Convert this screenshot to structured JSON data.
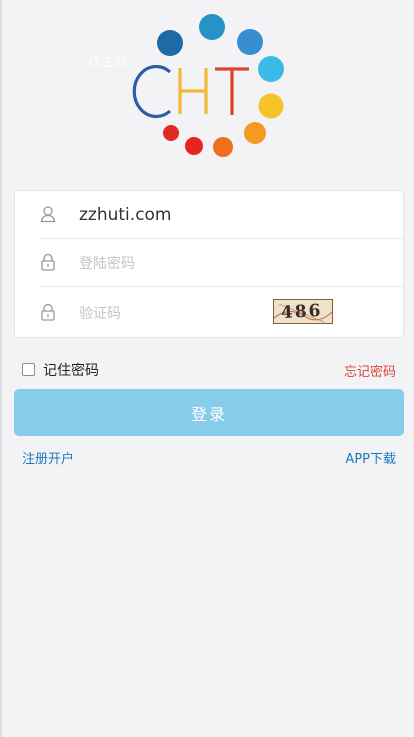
{
  "logo": {
    "letters": "CHT",
    "note": "找主题",
    "dot_colors": [
      "#1e6aa6",
      "#2593c7",
      "#3a8ed0",
      "#3bbbe8",
      "#f5c32a",
      "#f29a22",
      "#ee6f1e",
      "#e22a24",
      "#e8241f"
    ],
    "letter_colors": {
      "C": "#2b5da8",
      "H": "#f1b937",
      "T": "#e0432d"
    }
  },
  "form": {
    "username_value": "zzhuti.com",
    "password_placeholder": "登陆密码",
    "captcha_placeholder": "验证码",
    "captcha_text": "486"
  },
  "remember_label": "记住密码",
  "forgot_label": "忘记密码",
  "login_label": "登录",
  "register_label": "注册开户",
  "app_download_label": "APP下载",
  "colors": {
    "accent_button": "#87cdeb",
    "link": "#1a7ac0",
    "forgot": "#e0443a",
    "background": "#f3f3f6"
  }
}
